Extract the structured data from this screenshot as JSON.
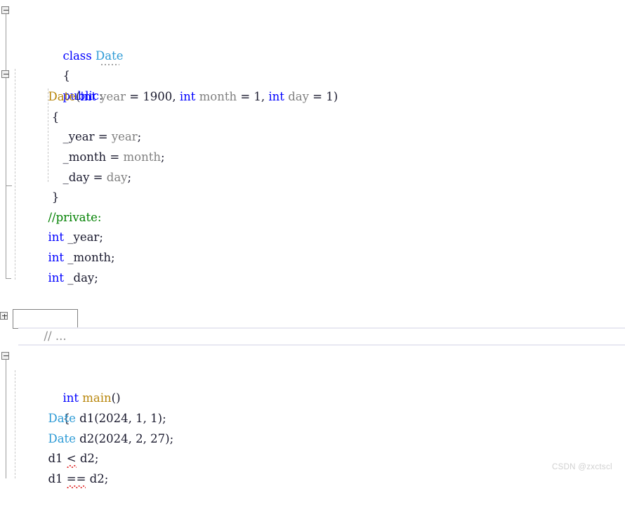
{
  "app": {
    "kind": "code-editor",
    "language": "C++",
    "background": "#ffffff",
    "watermark": "CSDN @zxctscl"
  },
  "palette": {
    "keyword": "#0000ff",
    "type": "#2e9bd6",
    "function": "#b8860b",
    "comment": "#008000",
    "parameter": "#808080",
    "plain": "#1a1a2e",
    "error_squiggle": "#e03030",
    "fold_guide": "#c8c8c8",
    "fold_marker_border": "#7a7a7a",
    "collapsed_border": "#808080",
    "rule": "#e8e8f2",
    "watermark": "#d0d0d0"
  },
  "collapsed_region": {
    "label": "// ...",
    "marker": "+",
    "expandable": true
  },
  "fold_markers": [
    {
      "name": "fold-class-date",
      "state": "expanded",
      "glyph": "-"
    },
    {
      "name": "fold-date-constructor",
      "state": "expanded",
      "glyph": "-"
    },
    {
      "name": "fold-collapsed-comment",
      "state": "collapsed",
      "glyph": "+"
    },
    {
      "name": "fold-main",
      "state": "expanded",
      "glyph": "-"
    }
  ],
  "code": {
    "l01": {
      "kw": "class",
      "type": "Date"
    },
    "l02": {
      "brace": "{"
    },
    "l03": {
      "kw": "public",
      "colon": ":"
    },
    "l04": {
      "fn": "Date",
      "open": "(",
      "kw1": "int",
      "p1": "year",
      "eq1": " = ",
      "v1": "1900",
      "c1": ", ",
      "kw2": "int",
      "p2": "month",
      "eq2": " = ",
      "v2": "1",
      "c2": ", ",
      "kw3": "int",
      "p3": "day",
      "eq3": " = ",
      "v3": "1",
      "close": ")"
    },
    "l05": {
      "brace": "{"
    },
    "l06": {
      "member": "_year",
      "op": " = ",
      "par": "year",
      "semi": ";"
    },
    "l07": {
      "member": "_month",
      "op": " = ",
      "par": "month",
      "semi": ";"
    },
    "l08": {
      "member": "_day",
      "op": " = ",
      "par": "day",
      "semi": ";"
    },
    "l09": {
      "brace": "}"
    },
    "l10": {
      "comment": "//private:"
    },
    "l11": {
      "kw": "int",
      "member": " _year;"
    },
    "l12": {
      "kw": "int",
      "member": " _month;"
    },
    "l13": {
      "kw": "int",
      "member": " _day;"
    },
    "l14": {
      "brace": "};"
    },
    "l15": {
      "kw": "int",
      "fn": "main",
      "parens": "()"
    },
    "l16": {
      "brace": "{"
    },
    "l17": {
      "type": "Date",
      "var": " d1",
      "args": "(2024, 1, 1);"
    },
    "l18": {
      "type": "Date",
      "var": " d2",
      "args": "(2024, 2, 27);"
    },
    "l19": {
      "lhs": "d1 ",
      "op": "<",
      "rhs": " d2;"
    },
    "l20": {
      "lhs": "d1 ",
      "op": "==",
      "rhs": " d2;"
    }
  },
  "diagnostics": [
    {
      "line": 19,
      "token": "<",
      "severity": "error",
      "underline": "red-squiggle"
    },
    {
      "line": 20,
      "token": "==",
      "severity": "error",
      "underline": "red-squiggle"
    }
  ]
}
